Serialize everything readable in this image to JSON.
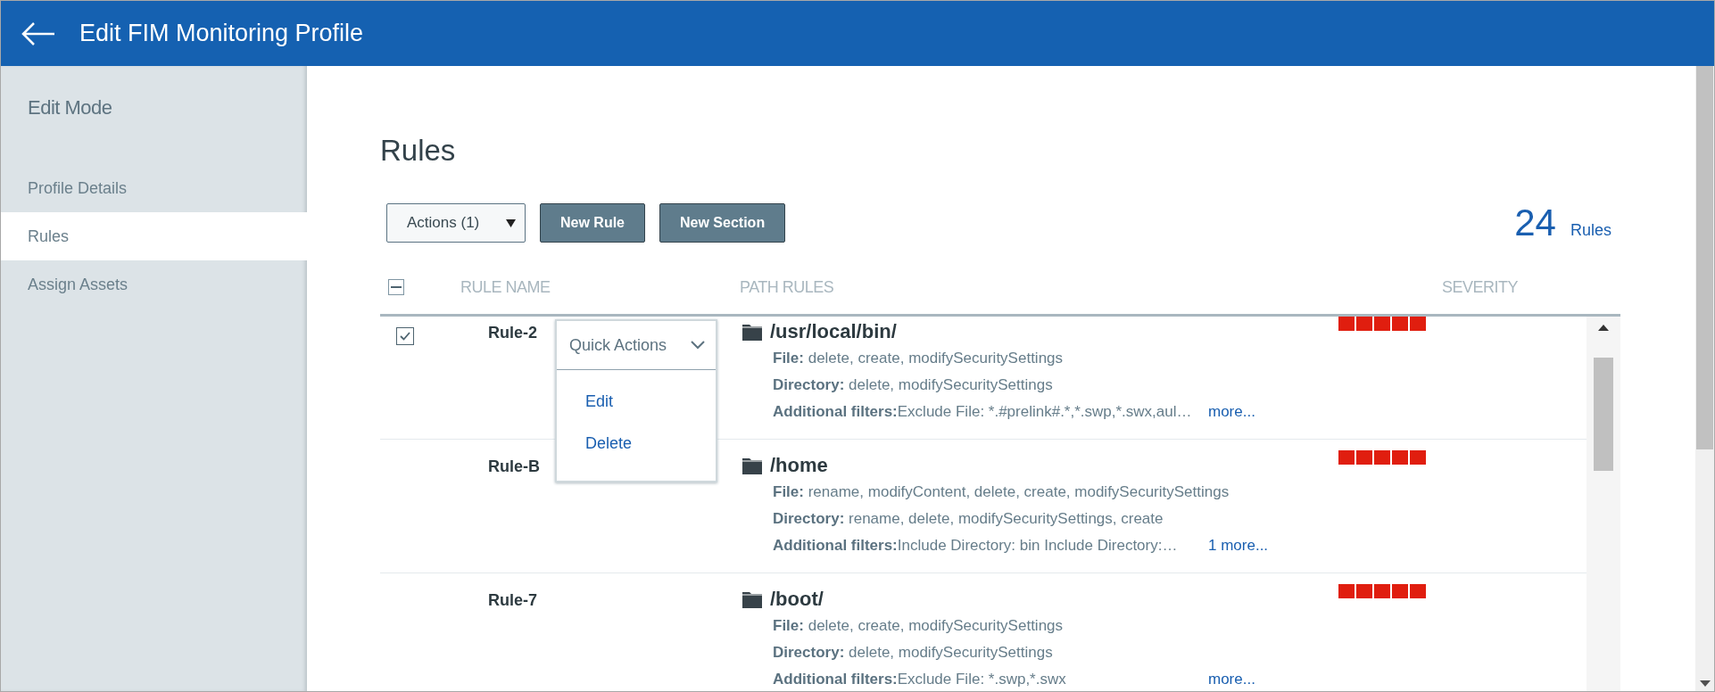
{
  "header": {
    "title": "Edit FIM Monitoring Profile"
  },
  "sidebar": {
    "heading": "Edit Mode",
    "items": [
      {
        "label": "Profile Details",
        "selected": false
      },
      {
        "label": "Rules",
        "selected": true
      },
      {
        "label": "Assign Assets",
        "selected": false
      }
    ]
  },
  "page": {
    "title": "Rules",
    "actions_select": "Actions (1)",
    "buttons": [
      "New Rule",
      "New Section"
    ],
    "count": "24",
    "count_label": "Rules"
  },
  "table": {
    "indeterminate": true,
    "columns": [
      "RULE NAME",
      "PATH RULES",
      "SEVERITY"
    ],
    "rows": [
      {
        "checked": true,
        "name": "Rule-2",
        "path": "/usr/local/bin/",
        "lines": [
          {
            "label": "File:",
            "text": "delete, create, modifySecuritySettings"
          },
          {
            "label": "Directory:",
            "text": "delete, modifySecuritySettings"
          }
        ],
        "filters_label": "Additional filters:",
        "filters": "Exclude File: *.#prelink#.*,*.swp,*.swx,aul…",
        "more": "more...",
        "stars": 5
      },
      {
        "checked": false,
        "name": "Rule-B",
        "path": "/home",
        "lines": [
          {
            "label": "File:",
            "text": "rename, modifyContent, delete, create, modifySecuritySettings"
          },
          {
            "label": "Directory:",
            "text": "rename, delete, modifySecuritySettings, create"
          }
        ],
        "filters_label": "Additional filters:",
        "filters": "Include Directory: bin Include Directory:…",
        "more": "1 more...",
        "stars": 5
      },
      {
        "checked": false,
        "name": "Rule-7",
        "path": "/boot/",
        "lines": [
          {
            "label": "File:",
            "text": "delete, create, modifySecuritySettings"
          },
          {
            "label": "Directory:",
            "text": "delete, modifySecuritySettings"
          }
        ],
        "filters_label": "Additional filters:",
        "filters": "Exclude File: *.swp,*.swx",
        "more": "more...",
        "stars": 5
      }
    ]
  },
  "quick_actions": {
    "title": "Quick Actions",
    "items": [
      "Edit",
      "Delete"
    ]
  }
}
